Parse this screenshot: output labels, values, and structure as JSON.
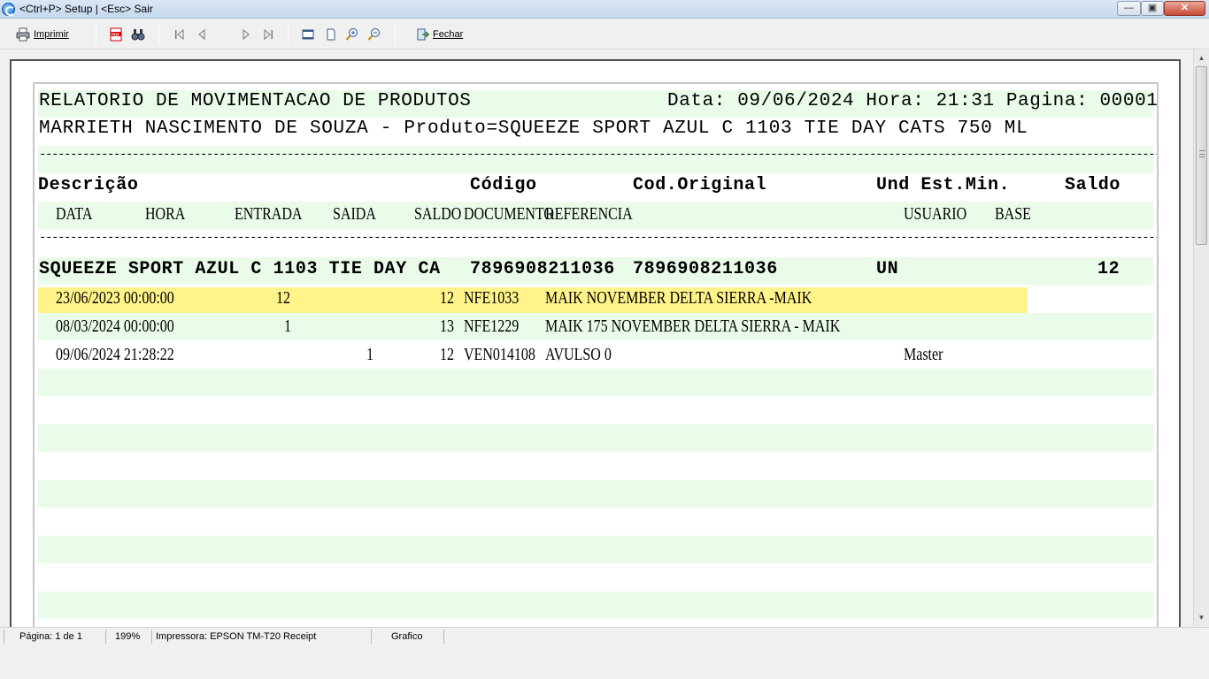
{
  "window": {
    "title": "<Ctrl+P> Setup | <Esc> Sair",
    "minimize_icon": "minimize-icon",
    "maximize_icon": "maximize-icon",
    "close_label": "✕"
  },
  "toolbar": {
    "print_label": "Imprimir",
    "close_label": "Fechar",
    "icons": [
      "printer-icon",
      "pdf-icon",
      "binoculars-icon",
      "first-page-icon",
      "prev-page-icon",
      "next-page-icon",
      "last-page-icon",
      "page-width-icon",
      "whole-page-icon",
      "zoom-in-icon",
      "zoom-out-icon",
      "exit-icon"
    ]
  },
  "report": {
    "title": "RELATORIO DE MOVIMENTACAO DE PRODUTOS",
    "date_info": "Data: 09/06/2024 Hora: 21:31 Pagina: 00001",
    "subtitle": "MARRIETH NASCIMENTO DE SOUZA - Produto=SQUEEZE SPORT AZUL C 1103 TIE DAY CATS 750 ML",
    "divider": "--------------------------------------------------------------------------------------------------------------------------------------------------------------------------------------",
    "headers": {
      "descricao": "Descrição",
      "codigo": "Código",
      "cod_original": "Cod.Original",
      "und_est_min": "Und Est.Min.",
      "saldo": "Saldo"
    },
    "subheaders": {
      "data": "DATA",
      "hora": "HORA",
      "entrada": "ENTRADA",
      "saida": "SAIDA",
      "saldo": "SALDO",
      "documento": "DOCUMENTO",
      "referencia": "REFERENCIA",
      "usuario": "USUARIO",
      "base": "BASE"
    },
    "product": {
      "descricao": "SQUEEZE SPORT AZUL C 1103 TIE DAY CA",
      "codigo": "7896908211036",
      "cod_original": "7896908211036",
      "und": "UN",
      "saldo": "12"
    },
    "movements": [
      {
        "data_hora": "23/06/2023 00:00:00",
        "entrada": "12",
        "saida": "",
        "saldo": "12",
        "documento": "NFE1033",
        "referencia": "MAIK NOVEMBER DELTA SIERRA -MAIK",
        "usuario": "",
        "base": ""
      },
      {
        "data_hora": "08/03/2024 00:00:00",
        "entrada": "1",
        "saida": "",
        "saldo": "13",
        "documento": "NFE1229",
        "referencia": "MAIK 175 NOVEMBER DELTA SIERRA - MAIK",
        "usuario": "",
        "base": ""
      },
      {
        "data_hora": "09/06/2024 21:28:22",
        "entrada": "",
        "saida": "1",
        "saldo": "12",
        "documento": "VEN014108",
        "referencia": "AVULSO 0",
        "usuario": "Master",
        "base": ""
      }
    ]
  },
  "statusbar": {
    "page": "Página: 1 de 1",
    "zoom": "199%",
    "printer": "Impressora: EPSON TM-T20 Receipt",
    "mode": "Grafico"
  }
}
